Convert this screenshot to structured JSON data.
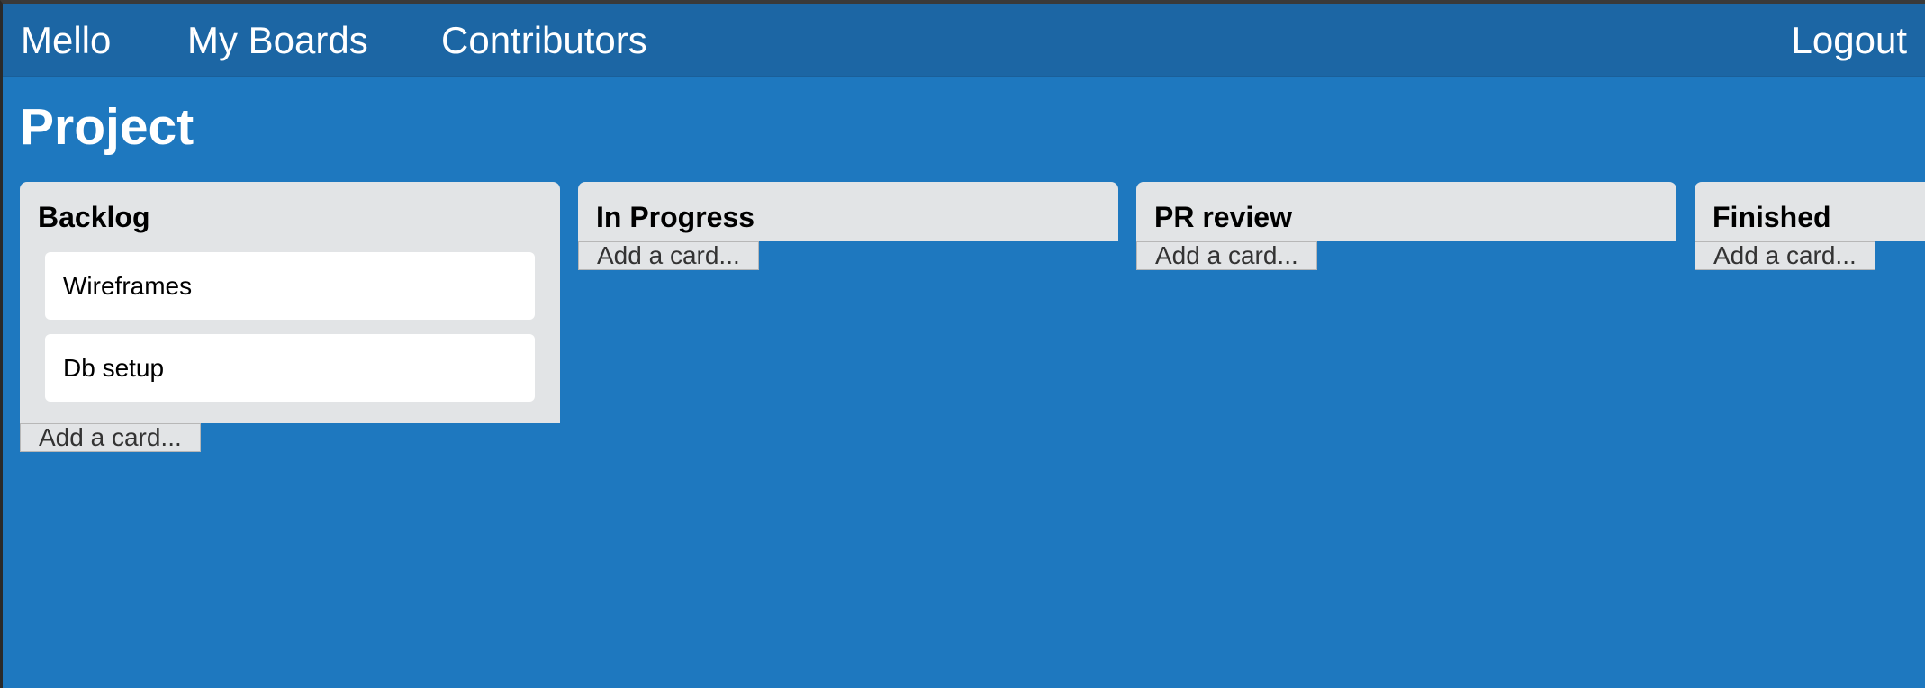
{
  "nav": {
    "brand": "Mello",
    "links": [
      "My Boards",
      "Contributors"
    ],
    "logout": "Logout"
  },
  "page": {
    "title": "Project"
  },
  "lists": [
    {
      "title": "Backlog",
      "cards": [
        "Wireframes",
        "Db setup"
      ],
      "add_label": "Add a card..."
    },
    {
      "title": "In Progress",
      "cards": [],
      "add_label": "Add a card..."
    },
    {
      "title": "PR review",
      "cards": [],
      "add_label": "Add a card..."
    },
    {
      "title": "Finished",
      "cards": [],
      "add_label": "Add a card..."
    }
  ],
  "colors": {
    "background": "#1e78bf",
    "navbar": "#1c66a4",
    "list_panel": "#e2e4e6",
    "card": "#ffffff"
  }
}
